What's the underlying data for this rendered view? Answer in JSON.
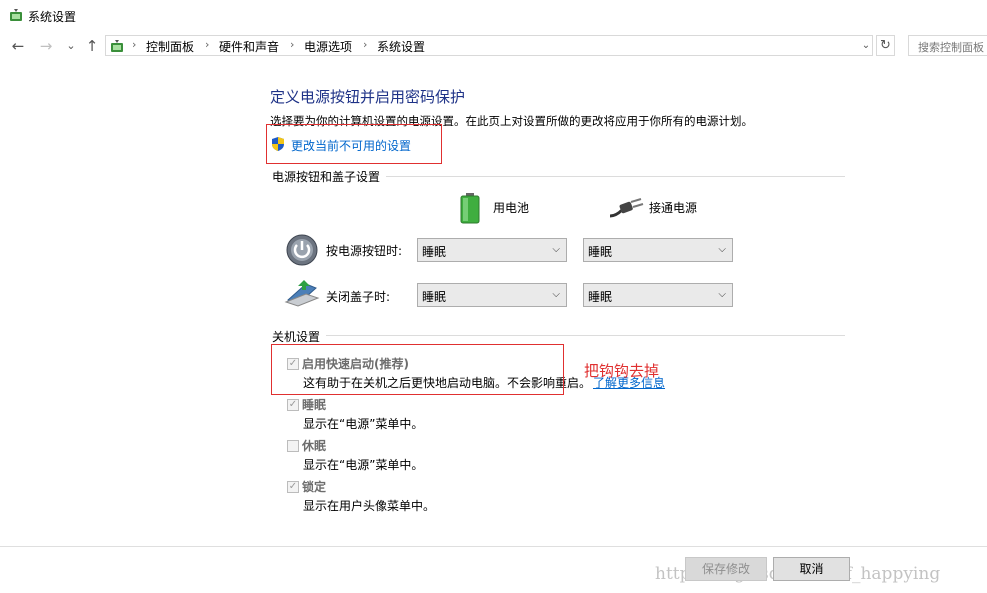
{
  "window": {
    "title": "系统设置"
  },
  "nav": {
    "back": "←",
    "forward": "→",
    "recent": "⌄",
    "up": "↑",
    "breadcrumbs": [
      "控制面板",
      "硬件和声音",
      "电源选项",
      "系统设置"
    ],
    "separator": "›",
    "dropdown": "⌄",
    "refresh": "↻",
    "search_placeholder": "搜索控制面板"
  },
  "main": {
    "heading": "定义电源按钮并启用密码保护",
    "description": "选择要为你的计算机设置的电源设置。在此页上对设置所做的更改将应用于你所有的电源计划。",
    "change_link": "更改当前不可用的设置",
    "power_group": {
      "title": "电源按钮和盖子设置",
      "col_battery": "用电池",
      "col_plugged": "接通电源",
      "rows": [
        {
          "label": "按电源按钮时:",
          "battery": "睡眠",
          "plugged": "睡眠"
        },
        {
          "label": "关闭盖子时:",
          "battery": "睡眠",
          "plugged": "睡眠"
        }
      ]
    },
    "shutdown_group": {
      "title": "关机设置",
      "items": [
        {
          "label": "启用快速启动(推荐)",
          "desc": "这有助于在关机之后更快地启动电脑。不会影响重启。",
          "checked": true
        },
        {
          "label": "睡眠",
          "desc": "显示在“电源”菜单中。",
          "checked": true
        },
        {
          "label": "休眠",
          "desc": "显示在“电源”菜单中。",
          "checked": false
        },
        {
          "label": "锁定",
          "desc": "显示在用户头像菜单中。",
          "checked": true
        }
      ],
      "learn_more": "了解更多信息"
    },
    "annotation": "把钩钩去掉"
  },
  "footer": {
    "save": "保存修改",
    "cancel": "取消"
  },
  "watermark": "http://blog.csdn.net/mf_happying",
  "colors": {
    "link": "#0066cc",
    "heading": "#1e3287",
    "annotation": "#e03030"
  },
  "icons": {
    "app": "power-options-icon",
    "shield": "uac-shield-icon",
    "battery": "battery-icon",
    "plug": "power-plug-icon",
    "power_button": "power-button-icon",
    "laptop_lid": "laptop-lid-icon"
  }
}
